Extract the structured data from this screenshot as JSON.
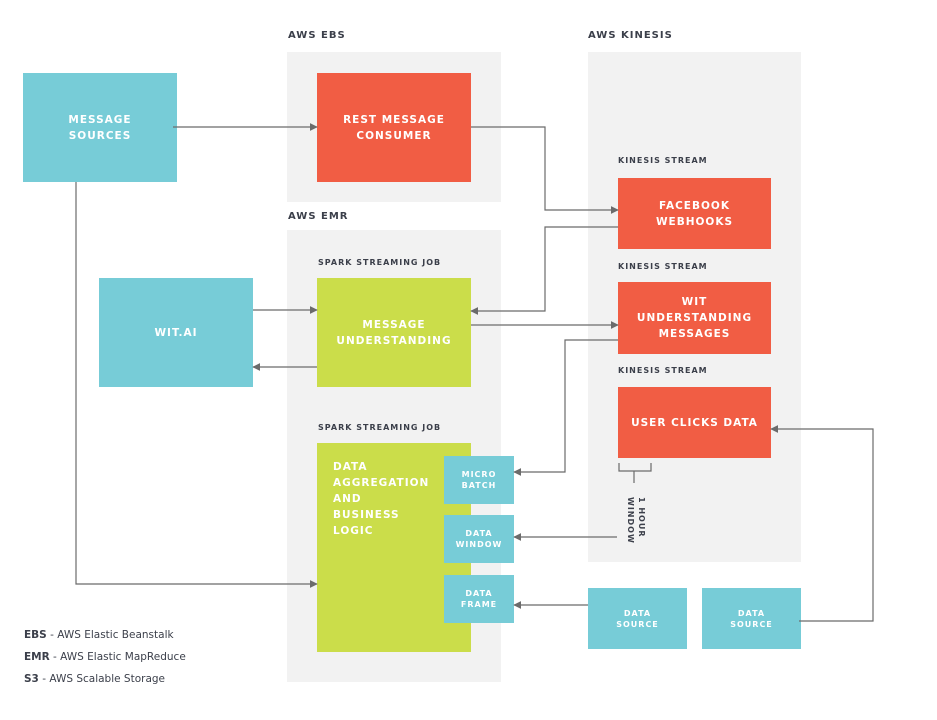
{
  "groups": {
    "ebs": {
      "title": "AWS EBS"
    },
    "emr": {
      "title": "AWS EMR"
    },
    "kinesis": {
      "title": "AWS KINESIS"
    }
  },
  "labels": {
    "kinesis_stream_1": "KINESIS STREAM",
    "kinesis_stream_2": "KINESIS STREAM",
    "kinesis_stream_3": "KINESIS STREAM",
    "spark_job_1": "SPARK STREAMING JOB",
    "spark_job_2": "SPARK STREAMING JOB"
  },
  "nodes": {
    "message_sources": {
      "lines": [
        "MESSAGE",
        "SOURCES"
      ]
    },
    "rest_consumer": {
      "lines": [
        "REST MESSAGE",
        "CONSUMER"
      ]
    },
    "facebook_webhooks": {
      "lines": [
        "FACEBOOK",
        "WEBHOOKS"
      ]
    },
    "wit_understanding": {
      "lines": [
        "WIT",
        "UNDERSTANDING",
        "MESSAGES"
      ]
    },
    "user_clicks": {
      "lines": [
        "USER CLICKS DATA"
      ]
    },
    "wit_ai": {
      "lines": [
        "WIT.AI"
      ]
    },
    "message_understanding": {
      "lines": [
        "MESSAGE",
        "UNDERSTANDING"
      ]
    },
    "data_aggregation": {
      "lines": [
        "DATA",
        "AGGREGATION",
        "AND",
        "BUSINESS",
        "LOGIC"
      ]
    },
    "micro_batch": {
      "lines": [
        "MICRO",
        "BATCH"
      ]
    },
    "data_window": {
      "lines": [
        "DATA",
        "WINDOW"
      ]
    },
    "data_frame": {
      "lines": [
        "DATA",
        "FRAME"
      ]
    },
    "data_source_1": {
      "lines": [
        "DATA",
        "SOURCE"
      ]
    },
    "data_source_2": {
      "lines": [
        "DATA",
        "SOURCE"
      ]
    }
  },
  "window_label": {
    "line1": "1 HOUR",
    "line2": "WINDOW"
  },
  "legend": [
    {
      "abbr": "EBS",
      "desc": " - AWS Elastic Beanstalk"
    },
    {
      "abbr": "EMR",
      "desc": " - AWS Elastic MapReduce"
    },
    {
      "abbr": "S3",
      "desc": " - AWS Scalable Storage"
    }
  ],
  "colors": {
    "source_teal": "#77ccd7",
    "kinesis_red": "#f15d44",
    "spark_green": "#cbdd4a",
    "group_bg": "#f2f2f2",
    "connector": "#6b6b6b"
  },
  "connections": [
    {
      "from": "message_sources",
      "to": "rest_consumer"
    },
    {
      "from": "rest_consumer",
      "to": "facebook_webhooks"
    },
    {
      "from": "facebook_webhooks",
      "to": "message_understanding"
    },
    {
      "from": "message_understanding",
      "to": "wit_understanding"
    },
    {
      "from": "wit_ai",
      "to": "message_understanding"
    },
    {
      "from": "message_understanding",
      "to": "wit_ai"
    },
    {
      "from": "wit_understanding",
      "to": "micro_batch"
    },
    {
      "from": "user_clicks",
      "to": "data_window"
    },
    {
      "from": "data_source_1",
      "to": "data_frame"
    },
    {
      "from": "data_source_2",
      "to": "user_clicks"
    },
    {
      "from": "message_sources",
      "to": "data_aggregation"
    }
  ]
}
